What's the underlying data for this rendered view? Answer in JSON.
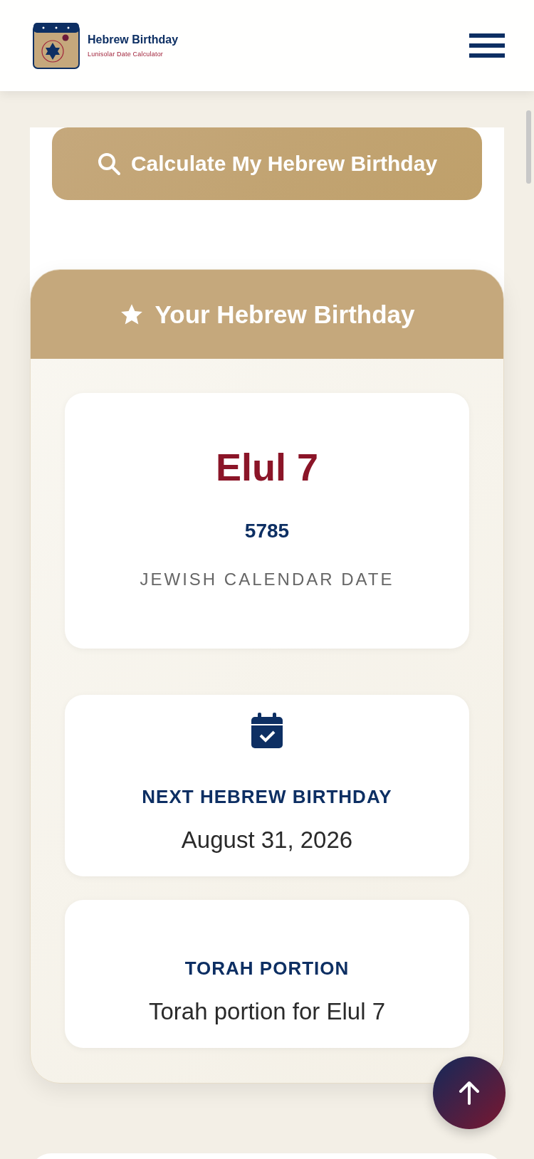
{
  "header": {
    "title": "Hebrew Birthday",
    "subtitle": "Lunisolar Date Calculator"
  },
  "form": {
    "calculate_button": "Calculate My Hebrew Birthday"
  },
  "result": {
    "title": "Your Hebrew Birthday",
    "hebrew_date": {
      "date": "Elul 7",
      "year": "5785",
      "label": "JEWISH CALENDAR DATE"
    },
    "cards": [
      {
        "kind": "next_birthday",
        "label": "NEXT HEBREW BIRTHDAY",
        "value": "August 31, 2026"
      },
      {
        "kind": "torah",
        "label": "TORAH PORTION",
        "value": "Torah portion for Elul 7"
      }
    ]
  }
}
